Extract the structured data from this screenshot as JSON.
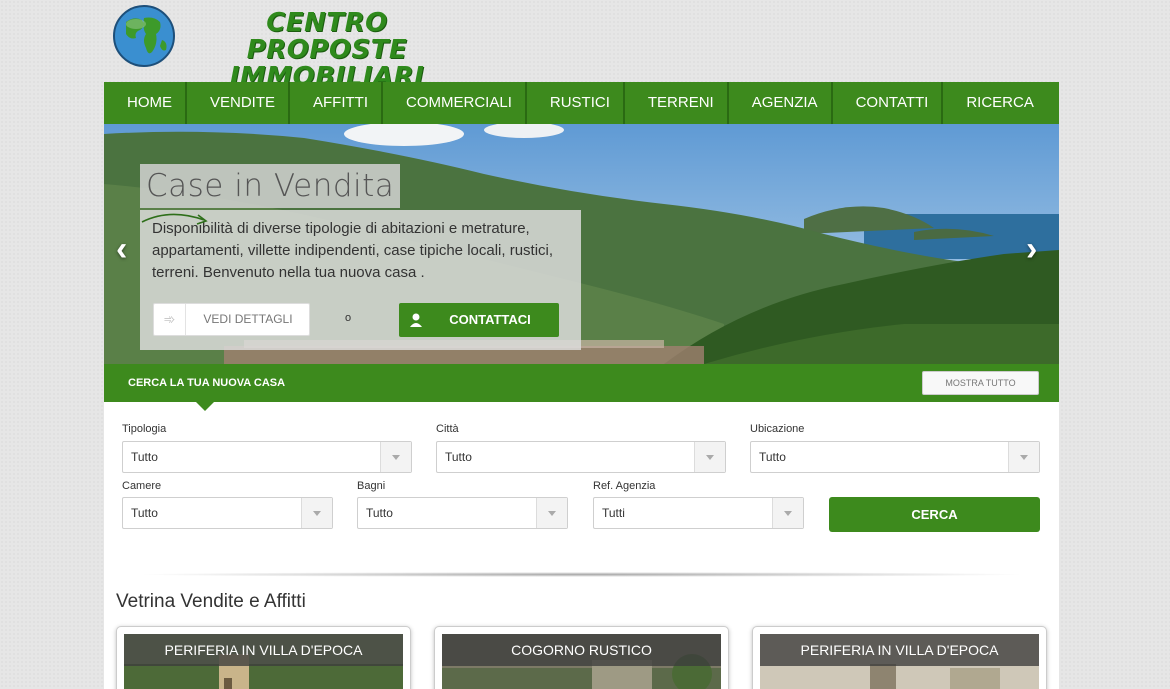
{
  "logo": {
    "line1": "CENTRO PROPOSTE",
    "line2": "IMMOBILIARI"
  },
  "nav": [
    "HOME",
    "VENDITE",
    "AFFITTI",
    "COMMERCIALI",
    "RUSTICI",
    "TERRENI",
    "AGENZIA",
    "CONTATTI",
    "RICERCA"
  ],
  "hero": {
    "title": "Case in Vendita",
    "description": "Disponibilità di diverse tipologie di abitazioni e metrature, appartamenti, villette indipendenti, case tipiche locali, rustici, terreni. Benvenuto nella tua nuova casa .",
    "details_button": "VEDI DETTAGLI",
    "or_label": "o",
    "contact_button": "CONTATTACI"
  },
  "search": {
    "title": "CERCA LA TUA NUOVA CASA",
    "show_all": "MOSTRA TUTTO",
    "fields": [
      {
        "label": "Tipologia",
        "value": "Tutto"
      },
      {
        "label": "Città",
        "value": "Tutto"
      },
      {
        "label": "Ubicazione",
        "value": "Tutto"
      },
      {
        "label": "Camere",
        "value": "Tutto"
      },
      {
        "label": "Bagni",
        "value": "Tutto"
      },
      {
        "label": "Ref. Agenzia",
        "value": "Tutti"
      }
    ],
    "search_button": "CERCA"
  },
  "showcase": {
    "title": "Vetrina Vendite e Affitti",
    "cards": [
      {
        "caption": "PERIFERIA IN VILLA D'EPOCA"
      },
      {
        "caption": "COGORNO RUSTICO"
      },
      {
        "caption": "PERIFERIA IN VILLA D'EPOCA"
      }
    ]
  },
  "colors": {
    "brand_green": "#3d8a1d",
    "logo_green": "#2f8a1c"
  }
}
